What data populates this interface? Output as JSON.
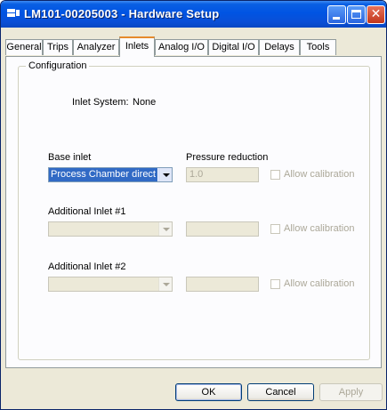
{
  "window": {
    "title": "LM101-00205003 - Hardware Setup"
  },
  "tabs": [
    "General",
    "Trips",
    "Analyzer",
    "Inlets",
    "Analog I/O",
    "Digital I/O",
    "Delays",
    "Tools"
  ],
  "active_tab": "Inlets",
  "group": {
    "title": "Configuration",
    "inlet_system_label": "Inlet System:",
    "inlet_system_value": "None"
  },
  "base_inlet": {
    "label": "Base inlet",
    "value": "Process Chamber direct",
    "pressure_label": "Pressure reduction",
    "pressure_value": "1.0",
    "calibration_label": "Allow calibration"
  },
  "additional_1": {
    "label": "Additional Inlet #1",
    "value": "",
    "pressure_value": "",
    "calibration_label": "Allow calibration"
  },
  "additional_2": {
    "label": "Additional Inlet #2",
    "value": "",
    "pressure_value": "",
    "calibration_label": "Allow calibration"
  },
  "buttons": {
    "ok": "OK",
    "cancel": "Cancel",
    "apply": "Apply"
  },
  "colors": {
    "title_bar": "#0054e3",
    "active_tab_accent": "#e68b2c",
    "selection": "#316ac5"
  }
}
